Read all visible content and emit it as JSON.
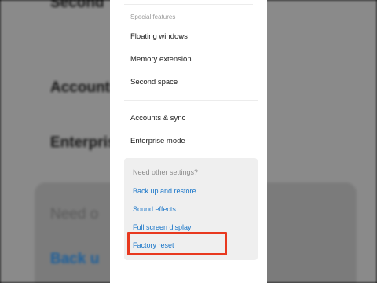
{
  "background": {
    "lines": [
      "Second",
      "Accounts",
      "Enterprise",
      "Need o",
      "Back u"
    ]
  },
  "settings": {
    "section_label": "Special features",
    "items": [
      {
        "label": "Floating windows"
      },
      {
        "label": "Memory extension"
      },
      {
        "label": "Second space"
      },
      {
        "label": "Accounts & sync"
      },
      {
        "label": "Enterprise mode"
      }
    ],
    "other_card": {
      "heading": "Need other settings?",
      "links": [
        {
          "label": "Back up and restore"
        },
        {
          "label": "Sound effects"
        },
        {
          "label": "Full screen display"
        },
        {
          "label": "Factory reset"
        }
      ]
    }
  },
  "colors": {
    "link": "#1976c9",
    "highlight": "#e8391f"
  }
}
